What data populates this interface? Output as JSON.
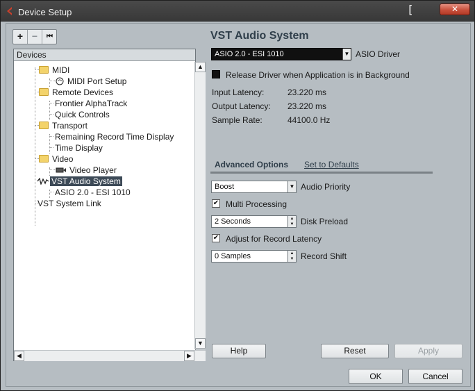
{
  "window": {
    "title": "Device Setup",
    "title_bracket": "[",
    "close_glyph": "✕"
  },
  "toolbar": {
    "add": "+",
    "remove": "−",
    "reset": "⏮"
  },
  "tree": {
    "header": "Devices",
    "items": [
      {
        "label": "MIDI",
        "icon": "folder-icon"
      },
      {
        "label": "MIDI Port Setup",
        "icon": "midi-port-icon"
      },
      {
        "label": "Remote Devices",
        "icon": "folder-icon"
      },
      {
        "label": "Frontier AlphaTrack",
        "icon": ""
      },
      {
        "label": "Quick Controls",
        "icon": ""
      },
      {
        "label": "Transport",
        "icon": "folder-icon"
      },
      {
        "label": "Remaining Record Time Display",
        "icon": ""
      },
      {
        "label": "Time Display",
        "icon": ""
      },
      {
        "label": "Video",
        "icon": "folder-icon"
      },
      {
        "label": "Video Player",
        "icon": "video-player-icon"
      },
      {
        "label": "VST Audio System",
        "icon": "audio-system-icon"
      },
      {
        "label": "ASIO 2.0 - ESI 1010",
        "icon": ""
      },
      {
        "label": "VST System Link",
        "icon": ""
      }
    ]
  },
  "panel": {
    "title": "VST Audio System",
    "asio_driver_value": "ASIO 2.0 - ESI 1010",
    "asio_driver_label": "ASIO Driver",
    "release_driver_label": "Release Driver when Application is in Background",
    "input_latency_label": "Input Latency:",
    "input_latency_value": "23.220 ms",
    "output_latency_label": "Output Latency:",
    "output_latency_value": "23.220 ms",
    "sample_rate_label": "Sample Rate:",
    "sample_rate_value": "44100.0 Hz",
    "advanced_options_tab": "Advanced Options",
    "set_to_defaults_link": "Set to Defaults",
    "audio_priority_value": "Boost",
    "audio_priority_label": "Audio Priority",
    "multi_processing_label": "Multi Processing",
    "disk_preload_value": "2 Seconds",
    "disk_preload_label": "Disk Preload",
    "adjust_record_latency_label": "Adjust for Record Latency",
    "record_shift_value": "0 Samples",
    "record_shift_label": "Record Shift"
  },
  "buttons": {
    "help": "Help",
    "reset": "Reset",
    "apply": "Apply",
    "ok": "OK",
    "cancel": "Cancel"
  }
}
